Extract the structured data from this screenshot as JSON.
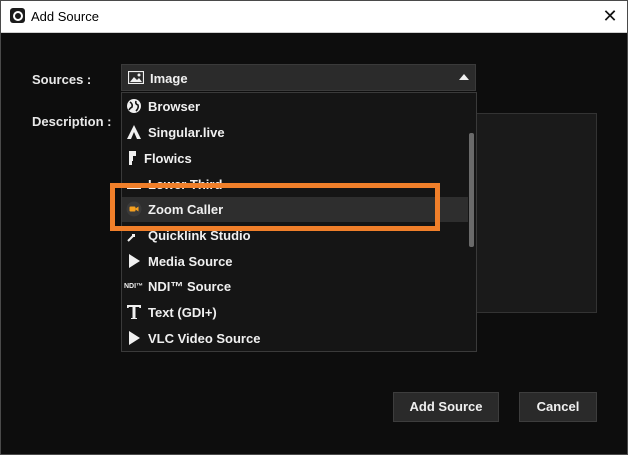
{
  "window": {
    "title": "Add Source",
    "close_glyph": "✕"
  },
  "form": {
    "sources_label": "Sources :",
    "description_label": "Description :"
  },
  "sources_combo": {
    "selected": "Image",
    "icon": "image-icon"
  },
  "dropdown": {
    "items": [
      {
        "label": "Browser",
        "icon": "globe-icon"
      },
      {
        "label": "Singular.live",
        "icon": "singular-icon"
      },
      {
        "label": "Flowics",
        "icon": "flowics-icon"
      },
      {
        "label": "Lower Third",
        "icon": "lower-third-icon"
      },
      {
        "label": "Zoom Caller",
        "icon": "camera-icon"
      },
      {
        "label": "Quicklink Studio",
        "icon": "quicklink-icon"
      },
      {
        "label": "Media Source",
        "icon": "play-icon"
      },
      {
        "label": "NDI™ Source",
        "icon": "ndi-icon"
      },
      {
        "label": "Text (GDI+)",
        "icon": "text-icon"
      },
      {
        "label": "VLC Video Source",
        "icon": "play-icon"
      }
    ],
    "selected_index": 4
  },
  "buttons": {
    "add_source": "Add Source",
    "cancel": "Cancel"
  },
  "colors": {
    "highlight": "#f07f2a",
    "background": "#0d0d0d",
    "accent_camera": "#f5a020"
  }
}
